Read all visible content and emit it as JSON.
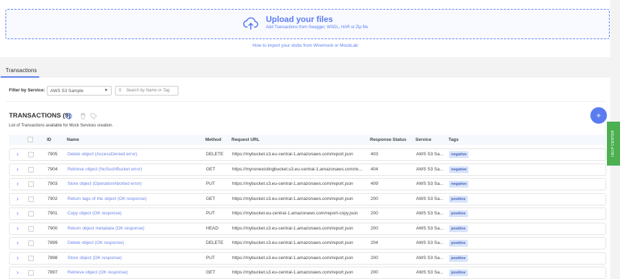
{
  "upload": {
    "title": "Upload your files",
    "subtitle": "Add Transactions from Swagger, WSDL, HAR or Zip file",
    "howto_link": "How to import your stubs from Wiremock or MockLab"
  },
  "tabs": [
    {
      "label": "Transactions",
      "active": true
    }
  ],
  "filter": {
    "label": "Filter by Service:",
    "service": "AWS S3 Sample",
    "search_placeholder": "Search by Name or Tag"
  },
  "section": {
    "title": "TRANSACTIONS (9)",
    "description": "List of Transactions available for Mock Services creation.",
    "add_label": "+"
  },
  "help_center": "HELP CENTER",
  "columns": [
    "ID",
    "Name",
    "Method",
    "Request URL",
    "Response Status",
    "Service",
    "Tags"
  ],
  "rows": [
    {
      "id": "7905",
      "name": "Delete object (AccessDenied error)",
      "method": "DELETE",
      "url": "https://mybucket.s3.eu-central-1.amazonaws.com/report.json",
      "status": "403",
      "service": "AWS S3 Sa...",
      "tag": "negative"
    },
    {
      "id": "7904",
      "name": "Retrieve object (NoSuchBucket error)",
      "method": "GET",
      "url": "https://mynonexistingbucket.s3.eu-central-1.amazonaws.com/re...",
      "status": "404",
      "service": "AWS S3 Sa...",
      "tag": "negative"
    },
    {
      "id": "7903",
      "name": "Store object (OperationAborted error)",
      "method": "PUT",
      "url": "https://mybucket.s3.eu-central-1.amazonaws.com/report.json",
      "status": "409",
      "service": "AWS S3 Sa...",
      "tag": "negative"
    },
    {
      "id": "7902",
      "name": "Return tags of the object (OK response)",
      "method": "GET",
      "url": "https://mybucket.s3.eu-central-1.amazonaws.com/report.json",
      "status": "200",
      "service": "AWS S3 Sa...",
      "tag": "positive"
    },
    {
      "id": "7901",
      "name": "Copy object (OK response)",
      "method": "PUT",
      "url": "https://mybucket.eu-central-1.amazonaws.com/report-copy.json",
      "status": "200",
      "service": "AWS S3 Sa...",
      "tag": "positive"
    },
    {
      "id": "7900",
      "name": "Return object metadata (OK response)",
      "method": "HEAD",
      "url": "https://mybucket.s3.eu-central-1.amazonaws.com/report.json",
      "status": "200",
      "service": "AWS S3 Sa...",
      "tag": "positive"
    },
    {
      "id": "7899",
      "name": "Delete object (OK response)",
      "method": "DELETE",
      "url": "https://mybucket.s3.eu-central-1.amazonaws.com/report.json",
      "status": "204",
      "service": "AWS S3 Sa...",
      "tag": "positive"
    },
    {
      "id": "7898",
      "name": "Store object (OK response)",
      "method": "PUT",
      "url": "https://mybucket.s3.eu-central-1.amazonaws.com/report.json",
      "status": "200",
      "service": "AWS S3 Sa...",
      "tag": "positive"
    },
    {
      "id": "7897",
      "name": "Retrieve object (OK response)",
      "method": "GET",
      "url": "https://mybucket.s3.eu-central-1.amazonaws.com/report.json",
      "status": "200",
      "service": "AWS S3 Sa...",
      "tag": "positive"
    }
  ]
}
